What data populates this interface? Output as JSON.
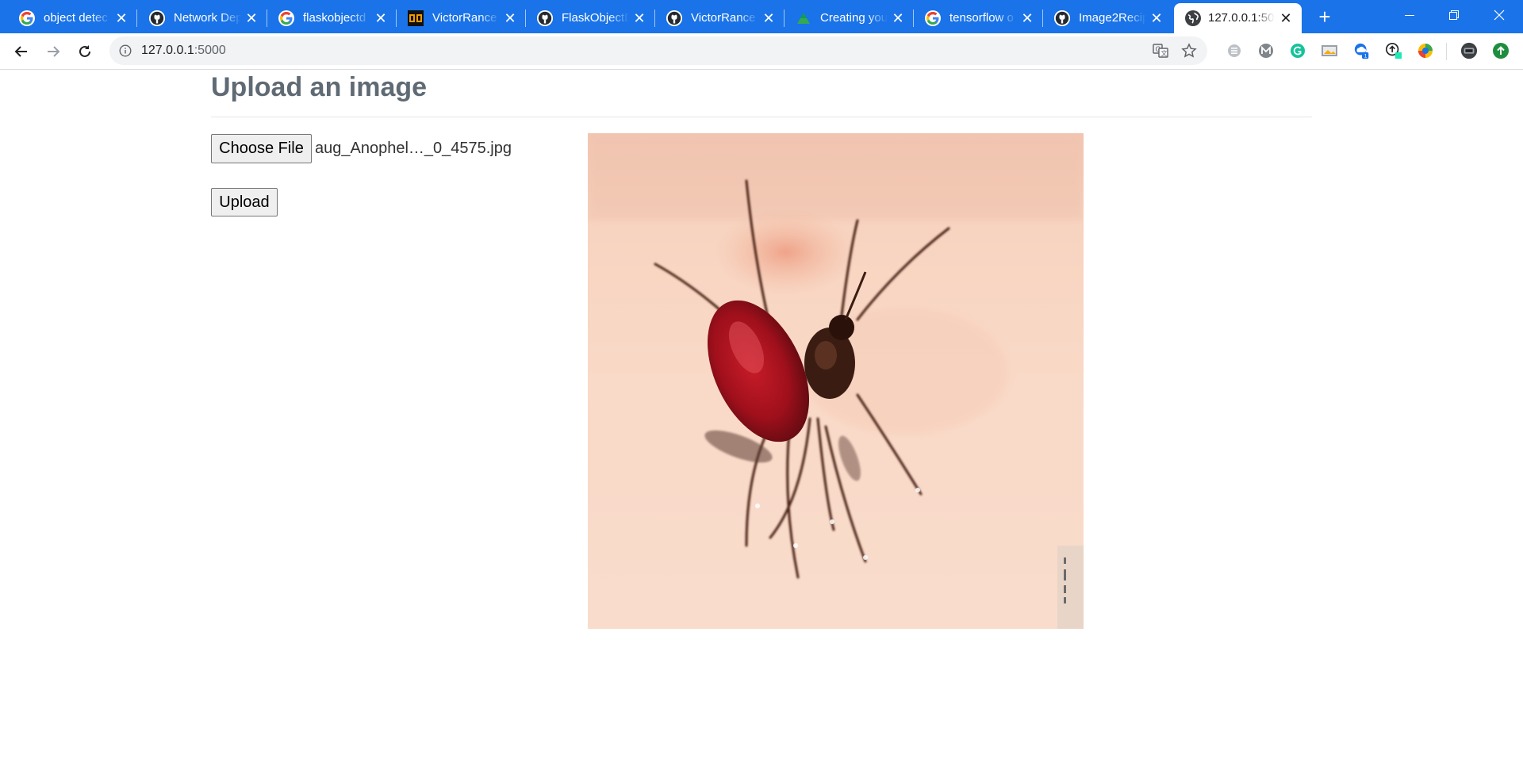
{
  "browser": {
    "tabs": [
      {
        "title": "object detec",
        "favicon": "google-icon"
      },
      {
        "title": "Network Dep",
        "favicon": "github-icon"
      },
      {
        "title": "flaskobjectd",
        "favicon": "google-icon"
      },
      {
        "title": "VictorRance",
        "favicon": "gm-icon"
      },
      {
        "title": "FlaskObjectD",
        "favicon": "github-icon"
      },
      {
        "title": "VictorRance",
        "favicon": "github-icon"
      },
      {
        "title": "Creating you",
        "favicon": "triangle-icon"
      },
      {
        "title": "tensorflow o",
        "favicon": "google-icon"
      },
      {
        "title": "Image2Recip",
        "favicon": "github-icon"
      },
      {
        "title": "127.0.0.1:500",
        "favicon": "globe-icon",
        "active": true
      }
    ],
    "close_glyph": "✕",
    "new_tab_glyph": "+",
    "address": {
      "host": "127.0.0.1",
      "port": ":5000"
    },
    "accent": "#1a73e8"
  },
  "page": {
    "heading": "Upload an image",
    "choose_file_label": "Choose File",
    "chosen_file_name": "aug_Anophel…_0_4575.jpg",
    "upload_label": "Upload",
    "heading_color": "#5f6a74"
  }
}
